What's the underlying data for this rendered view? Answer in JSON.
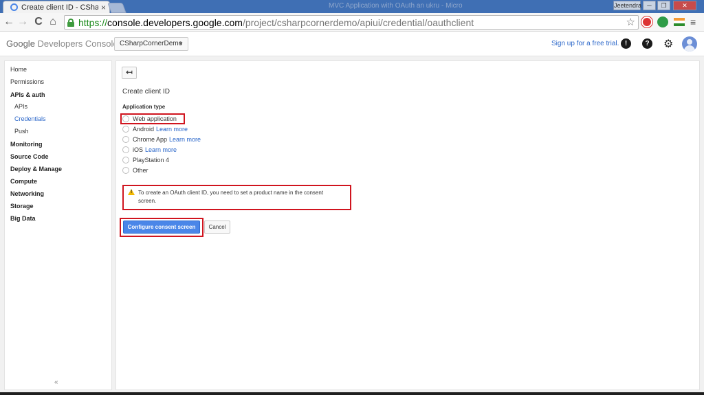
{
  "browser": {
    "tab_title": "Create client ID - CSharpC",
    "tab_close": "×",
    "window_title_ghost": "MVC Application with OAuth an ukru - Micro",
    "user_chip": "Jeetendra",
    "minimize": "─",
    "maximize": "❐",
    "close": "✕",
    "back": "←",
    "forward": "→",
    "reload": "C",
    "home": "⌂",
    "url_scheme": "https://",
    "url_host": "console.developers.google.com",
    "url_path": "/project/csharpcornerdemo/apiui/credential/oauthclient",
    "star": "☆",
    "menu": "≡"
  },
  "header": {
    "brand_google": "Google",
    "brand_product": "Developers Console",
    "project": "CSharpCornerDemo",
    "caret": "▼",
    "signup_link": "Sign up for a free trial.",
    "feedback_glyph": "!",
    "help_glyph": "?",
    "settings_glyph": "⚙"
  },
  "sidebar": {
    "items": [
      {
        "label": "Home"
      },
      {
        "label": "Permissions"
      },
      {
        "label": "APIs & auth"
      },
      {
        "label": "APIs"
      },
      {
        "label": "Credentials"
      },
      {
        "label": "Push"
      },
      {
        "label": "Monitoring"
      },
      {
        "label": "Source Code"
      },
      {
        "label": "Deploy & Manage"
      },
      {
        "label": "Compute"
      },
      {
        "label": "Networking"
      },
      {
        "label": "Storage"
      },
      {
        "label": "Big Data"
      }
    ],
    "collapse": "«"
  },
  "main": {
    "back_glyph": "↤",
    "title": "Create client ID",
    "application_type_label": "Application type",
    "options": [
      {
        "label": "Web application",
        "link": ""
      },
      {
        "label": "Android",
        "link": "Learn more"
      },
      {
        "label": "Chrome App",
        "link": "Learn more"
      },
      {
        "label": "iOS",
        "link": "Learn more"
      },
      {
        "label": "PlayStation 4",
        "link": ""
      },
      {
        "label": "Other",
        "link": ""
      }
    ],
    "warning": "To create an OAuth client ID, you need to set a product name in the consent screen.",
    "configure_button": "Configure consent screen",
    "cancel_button": "Cancel"
  },
  "colors": {
    "accent": "#4a86e8",
    "link": "#2a66c9",
    "highlight": "#d0141e",
    "warning": "#f2b800"
  }
}
